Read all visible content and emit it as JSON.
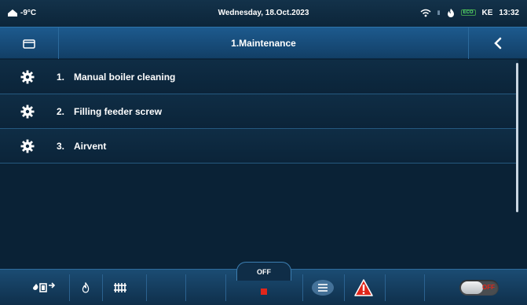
{
  "status": {
    "temperature": "-9°C",
    "date": "Wednesday, 18.Oct.2023",
    "eco_badge": "ECO",
    "user": "KE",
    "time": "13:32"
  },
  "header": {
    "title": "1.Maintenance"
  },
  "items": [
    {
      "number": "1.",
      "label": "Manual boiler cleaning"
    },
    {
      "number": "2.",
      "label": "Filling feeder screw"
    },
    {
      "number": "3.",
      "label": "Airvent"
    }
  ],
  "bottom": {
    "mode": "OFF",
    "toggle_label": "OFF"
  },
  "colors": {
    "background": "#0a2236",
    "header": "#1d5a8e",
    "alarm": "#e0261b"
  }
}
